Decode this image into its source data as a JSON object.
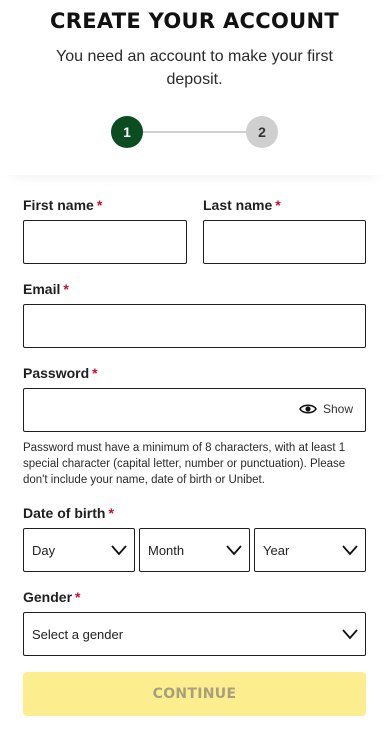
{
  "header": {
    "title": "CREATE YOUR ACCOUNT",
    "subtitle": "You need an account to make your first deposit."
  },
  "stepper": {
    "steps": [
      "1",
      "2"
    ],
    "current_step": 1,
    "colors": {
      "active": "#0b4d20",
      "inactive": "#cfcfcf"
    }
  },
  "form": {
    "required_marker": "*",
    "first_name": {
      "label": "First name",
      "value": ""
    },
    "last_name": {
      "label": "Last name",
      "value": ""
    },
    "email": {
      "label": "Email",
      "value": ""
    },
    "password": {
      "label": "Password",
      "value": "",
      "show_label": "Show",
      "show_icon": "eye-icon",
      "hint": "Password must have a minimum of 8 characters, with at least 1 special character (capital letter, number or punctuation). Please don't include your name, date of birth or Unibet."
    },
    "date_of_birth": {
      "label": "Date of birth",
      "day": "Day",
      "month": "Month",
      "year": "Year"
    },
    "gender": {
      "label": "Gender",
      "selected": "Select a gender"
    }
  },
  "continue_button": {
    "label": "CONTINUE",
    "color": "#fcee8f",
    "disabled": true
  }
}
